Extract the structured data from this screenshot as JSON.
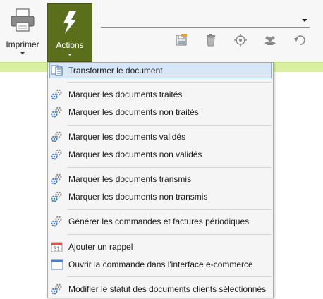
{
  "ribbon": {
    "print_label": "Imprimer",
    "actions_label": "Actions",
    "combo_value": "",
    "tools": [
      "save-icon",
      "trash-icon",
      "target-icon",
      "users-icon",
      "undo-icon"
    ]
  },
  "colors": {
    "actions_bg": "#5b6e1c",
    "strip": "#d9efa1",
    "selected": "#d8e6f6"
  },
  "menu": {
    "items": [
      {
        "label": "Transformer le document",
        "icon": "transform-document-icon"
      },
      {
        "label": "Marquer les documents traités",
        "icon": "gears-icon"
      },
      {
        "label": "Marquer les documents non traités",
        "icon": "gears-icon"
      },
      {
        "label": "Marquer les documents validés",
        "icon": "gears-icon"
      },
      {
        "label": "Marquer les documents non validés",
        "icon": "gears-icon"
      },
      {
        "label": "Marquer les documents transmis",
        "icon": "gears-icon"
      },
      {
        "label": "Marquer les documents non transmis",
        "icon": "gears-icon"
      },
      {
        "label": "Générer les commandes et factures périodiques",
        "icon": "gears-icon"
      },
      {
        "label": "Ajouter un rappel",
        "icon": "calendar-icon",
        "icon_text": "31"
      },
      {
        "label": "Ouvrir la commande dans l'interface e-commerce",
        "icon": "window-icon"
      },
      {
        "label": "Modifier le statut des documents clients sélectionnés",
        "icon": "gears-icon"
      }
    ]
  }
}
